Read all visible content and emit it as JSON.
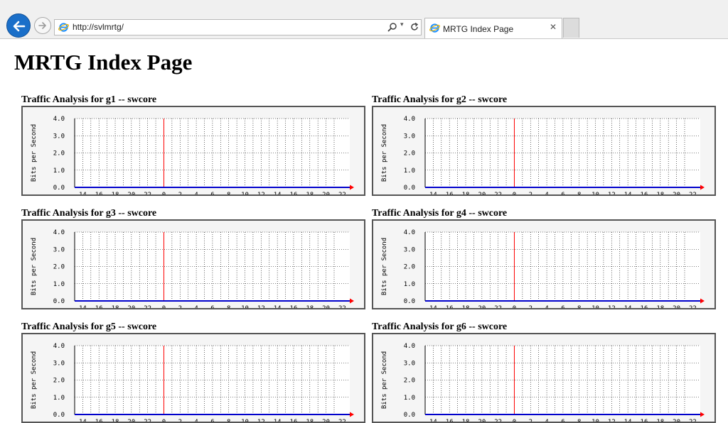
{
  "browser": {
    "url": "http://svlmrtg/",
    "tab_title": "MRTG Index Page"
  },
  "page": {
    "heading": "MRTG Index Page"
  },
  "panels": [
    {
      "title": "Traffic Analysis for g1 -- swcore"
    },
    {
      "title": "Traffic Analysis for g2 -- swcore"
    },
    {
      "title": "Traffic Analysis for g3 -- swcore"
    },
    {
      "title": "Traffic Analysis for g4 -- swcore"
    },
    {
      "title": "Traffic Analysis for g5 -- swcore"
    },
    {
      "title": "Traffic Analysis for g6 -- swcore"
    }
  ],
  "chart_data": {
    "type": "line",
    "ylabel": "Bits per Second",
    "y_ticks": [
      "0.0",
      "1.0",
      "2.0",
      "3.0",
      "4.0"
    ],
    "ylim": [
      0,
      4
    ],
    "x_ticks": [
      "14",
      "16",
      "18",
      "20",
      "22",
      "0",
      "2",
      "4",
      "6",
      "8",
      "10",
      "12",
      "14",
      "16",
      "18",
      "20",
      "22"
    ],
    "series": [
      {
        "values": [
          0,
          0,
          0,
          0,
          0,
          0,
          0,
          0,
          0,
          0,
          0,
          0,
          0,
          0,
          0,
          0,
          0
        ],
        "color": "#0000cc"
      }
    ],
    "midnight_marker_color": "#ff0000",
    "grid": true
  }
}
